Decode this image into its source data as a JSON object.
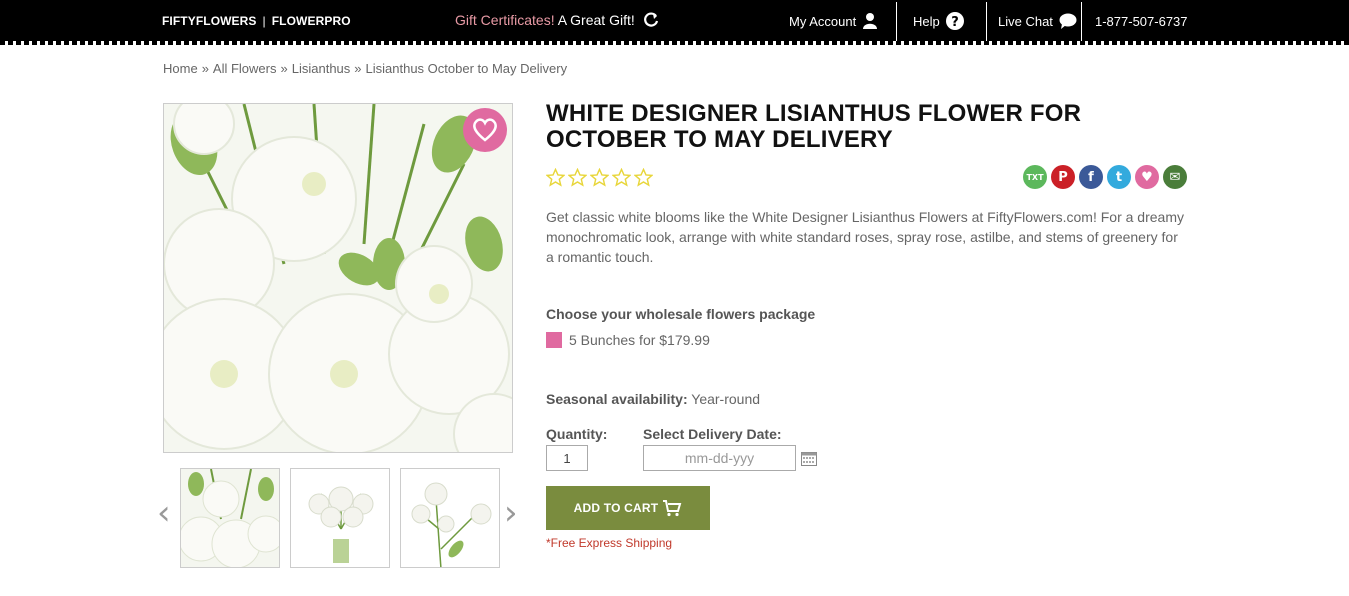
{
  "topbar": {
    "brand_left": "FIFTYFLOWERS",
    "brand_sep": "|",
    "brand_right": "FLOWERPRO",
    "gift_highlight": "Gift Certificates!",
    "gift_text": " A Great Gift!",
    "my_account": "My Account",
    "help": "Help",
    "live_chat": "Live Chat",
    "phone": "1-877-507-6737"
  },
  "breadcrumb": {
    "items": [
      "Home",
      "All Flowers",
      "Lisianthus",
      "Lisianthus October to May Delivery"
    ],
    "separator": "»"
  },
  "product": {
    "title": "WHITE DESIGNER LISIANTHUS FLOWER FOR OCTOBER TO MAY DELIVERY",
    "rating": 0,
    "rating_max": 5,
    "description": "Get classic white blooms like the White Designer Lisianthus Flowers at FiftyFlowers.com! For a dreamy monochromatic look, arrange with white standard roses, spray rose, astilbe, and stems of greenery for a romantic touch.",
    "package_heading": "Choose your wholesale flowers package",
    "package_option": "5 Bunches for $179.99",
    "seasonal_label": "Seasonal availability:",
    "seasonal_value": " Year-round",
    "quantity_label": "Quantity:",
    "quantity_value": "1",
    "delivery_label": "Select Delivery Date:",
    "delivery_placeholder": "mm-dd-yyy",
    "add_to_cart": "ADD TO CART",
    "free_shipping": "*Free Express Shipping"
  },
  "share": {
    "icons": [
      "text-icon",
      "pinterest-icon",
      "facebook-icon",
      "twitter-icon",
      "heart-icon",
      "email-icon"
    ],
    "text_badge": "TXT",
    "colors": [
      "#5cb85c",
      "#cb2027",
      "#3b5998",
      "#33aadd",
      "#e06aa0",
      "#4a7d3a"
    ]
  },
  "gallery": {
    "prev": "‹",
    "next": "›",
    "thumbnails": [
      "bouquet-closeup",
      "vase-arrangement",
      "single-stems"
    ]
  },
  "colors": {
    "topbar": "#000000",
    "accent_pink": "#e06aa0",
    "cart_green": "#7a8c3e",
    "star_yellow": "#e8d63a",
    "shipping_red": "#c0392b"
  }
}
